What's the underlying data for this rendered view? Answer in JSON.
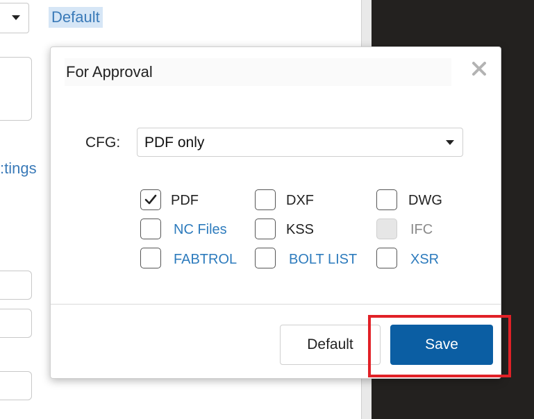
{
  "background": {
    "top_link": "Default",
    "partial_link": ":tings"
  },
  "dialog": {
    "title_value": "For Approval",
    "cfg_label": "CFG:",
    "cfg_value": "PDF only",
    "options": [
      {
        "label": "PDF",
        "checked": true,
        "style": "default"
      },
      {
        "label": "DXF",
        "checked": false,
        "style": "default"
      },
      {
        "label": "DWG",
        "checked": false,
        "style": "default"
      },
      {
        "label": "NC Files",
        "checked": false,
        "style": "link"
      },
      {
        "label": "KSS",
        "checked": false,
        "style": "default"
      },
      {
        "label": "IFC",
        "checked": false,
        "style": "disabled"
      },
      {
        "label": "FABTROL",
        "checked": false,
        "style": "link"
      },
      {
        "label": "BOLT LIST",
        "checked": false,
        "style": "link"
      },
      {
        "label": "XSR",
        "checked": false,
        "style": "link"
      }
    ],
    "buttons": {
      "default_label": "Default",
      "save_label": "Save"
    }
  },
  "colors": {
    "link": "#2d7bbd",
    "primary_button": "#0b5ea3",
    "highlight_box": "#e12127",
    "dark_panel": "#23211f"
  },
  "icons": {
    "close": "close-icon",
    "check": "checkmark-icon",
    "dropdown": "chevron-down-icon"
  }
}
